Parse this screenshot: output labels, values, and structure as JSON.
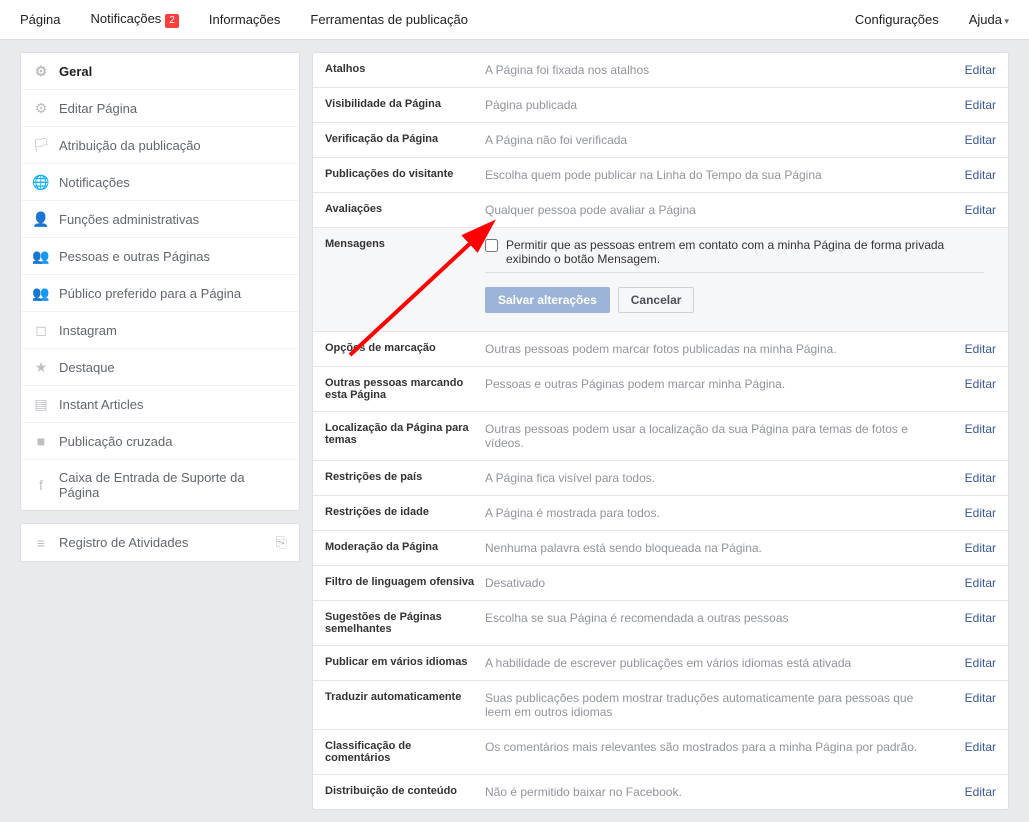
{
  "topnav": {
    "left": [
      {
        "label": "Página",
        "name": "nav-page"
      },
      {
        "label": "Notificações",
        "name": "nav-notifications",
        "badge": "2"
      },
      {
        "label": "Informações",
        "name": "nav-info"
      },
      {
        "label": "Ferramentas de publicação",
        "name": "nav-publishing-tools"
      }
    ],
    "right": [
      {
        "label": "Configurações",
        "name": "nav-settings"
      },
      {
        "label": "Ajuda",
        "name": "nav-help",
        "dropdown": true
      }
    ]
  },
  "sidebar": {
    "groups": [
      [
        {
          "label": "Geral",
          "icon": "⚙",
          "name": "sidebar-general",
          "active": true
        },
        {
          "label": "Editar Página",
          "icon": "⚙",
          "name": "sidebar-edit-page"
        },
        {
          "label": "Atribuição da publicação",
          "icon": "🏳",
          "name": "sidebar-post-attribution"
        },
        {
          "label": "Notificações",
          "icon": "🌐",
          "name": "sidebar-notifications"
        },
        {
          "label": "Funções administrativas",
          "icon": "👤",
          "name": "sidebar-admin-roles"
        },
        {
          "label": "Pessoas e outras Páginas",
          "icon": "👥",
          "name": "sidebar-people-pages"
        },
        {
          "label": "Público preferido para a Página",
          "icon": "👥",
          "name": "sidebar-preferred-audience"
        },
        {
          "label": "Instagram",
          "icon": "◻",
          "name": "sidebar-instagram"
        },
        {
          "label": "Destaque",
          "icon": "★",
          "name": "sidebar-featured"
        },
        {
          "label": "Instant Articles",
          "icon": "▤",
          "name": "sidebar-instant-articles"
        },
        {
          "label": "Publicação cruzada",
          "icon": "■",
          "name": "sidebar-crossposting"
        },
        {
          "label": "Caixa de Entrada de Suporte da Página",
          "icon": "f",
          "name": "sidebar-support-inbox"
        }
      ],
      [
        {
          "label": "Registro de Atividades",
          "icon": "≡",
          "name": "sidebar-activity-log",
          "exit": true
        }
      ]
    ]
  },
  "settings": {
    "edit_label": "Editar",
    "rows": [
      {
        "label": "Atalhos",
        "value": "A Página foi fixada nos atalhos"
      },
      {
        "label": "Visibilidade da Página",
        "value": "Página publicada"
      },
      {
        "label": "Verificação da Página",
        "value": "A Página não foi verificada"
      },
      {
        "label": "Publicações do visitante",
        "value": "Escolha quem pode publicar na Linha do Tempo da sua Página"
      },
      {
        "label": "Avaliações",
        "value": "Qualquer pessoa pode avaliar a Página"
      },
      {
        "label": "Mensagens",
        "expanded": true,
        "checkbox_text": "Permitir que as pessoas entrem em contato com a minha Página de forma privada exibindo o botão Mensagem.",
        "save": "Salvar alterações",
        "cancel": "Cancelar"
      },
      {
        "label": "Opções de marcação",
        "value": "Outras pessoas podem marcar fotos publicadas na minha Página."
      },
      {
        "label": "Outras pessoas marcando esta Página",
        "value": "Pessoas e outras Páginas podem marcar minha Página."
      },
      {
        "label": "Localização da Página para temas",
        "value": "Outras pessoas podem usar a localização da sua Página para temas de fotos e vídeos."
      },
      {
        "label": "Restrições de país",
        "value": "A Página fica visível para todos."
      },
      {
        "label": "Restrições de idade",
        "value": "A Página é mostrada para todos."
      },
      {
        "label": "Moderação da Página",
        "value": "Nenhuma palavra está sendo bloqueada na Página."
      },
      {
        "label": "Filtro de linguagem ofensiva",
        "value": "Desativado"
      },
      {
        "label": "Sugestões de Páginas semelhantes",
        "value": "Escolha se sua Página é recomendada a outras pessoas"
      },
      {
        "label": "Publicar em vários idiomas",
        "value": "A habilidade de escrever publicações em vários idiomas está ativada"
      },
      {
        "label": "Traduzir automaticamente",
        "value": "Suas publicações podem mostrar traduções automaticamente para pessoas que leem em outros idiomas"
      },
      {
        "label": "Classificação de comentários",
        "value": "Os comentários mais relevantes são mostrados para a minha Página por padrão."
      },
      {
        "label": "Distribuição de conteúdo",
        "value": "Não é permitido baixar no Facebook."
      }
    ]
  }
}
